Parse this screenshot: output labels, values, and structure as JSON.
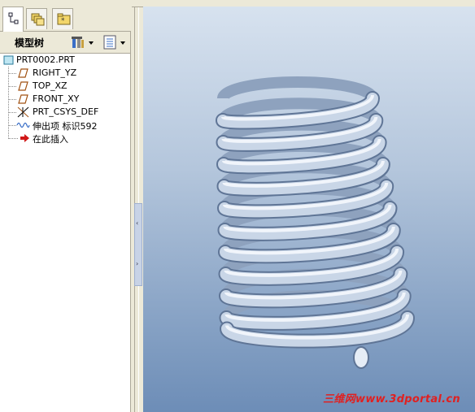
{
  "tabs": [
    {
      "name": "model-tree",
      "icon": "tree-icon"
    },
    {
      "name": "folder-browser",
      "icon": "folders-icon"
    },
    {
      "name": "favorites",
      "icon": "favorites-icon"
    }
  ],
  "tree_header": {
    "title": "模型树",
    "settings_icon": "settings-icon",
    "show_icon": "show-icon"
  },
  "tree": {
    "root": "PRT0002.PRT",
    "items": [
      {
        "label": "RIGHT_YZ",
        "icon": "datum-plane-icon"
      },
      {
        "label": "TOP_XZ",
        "icon": "datum-plane-icon"
      },
      {
        "label": "FRONT_XY",
        "icon": "datum-plane-icon"
      },
      {
        "label": "PRT_CSYS_DEF",
        "icon": "csys-icon"
      },
      {
        "label": "伸出项 标识592",
        "icon": "sweep-feature-icon"
      },
      {
        "label": "在此插入",
        "icon": "insert-arrow-icon"
      }
    ]
  },
  "viewport": {
    "model": "helical-spring",
    "watermark": "三维网www.3dportal.cn"
  },
  "colors": {
    "panel_bg": "#ece9d8",
    "viewport_top": "#d7e2ef",
    "viewport_bottom": "#6d8db7",
    "spring": "#c6d3e4",
    "watermark": "#e02020"
  }
}
